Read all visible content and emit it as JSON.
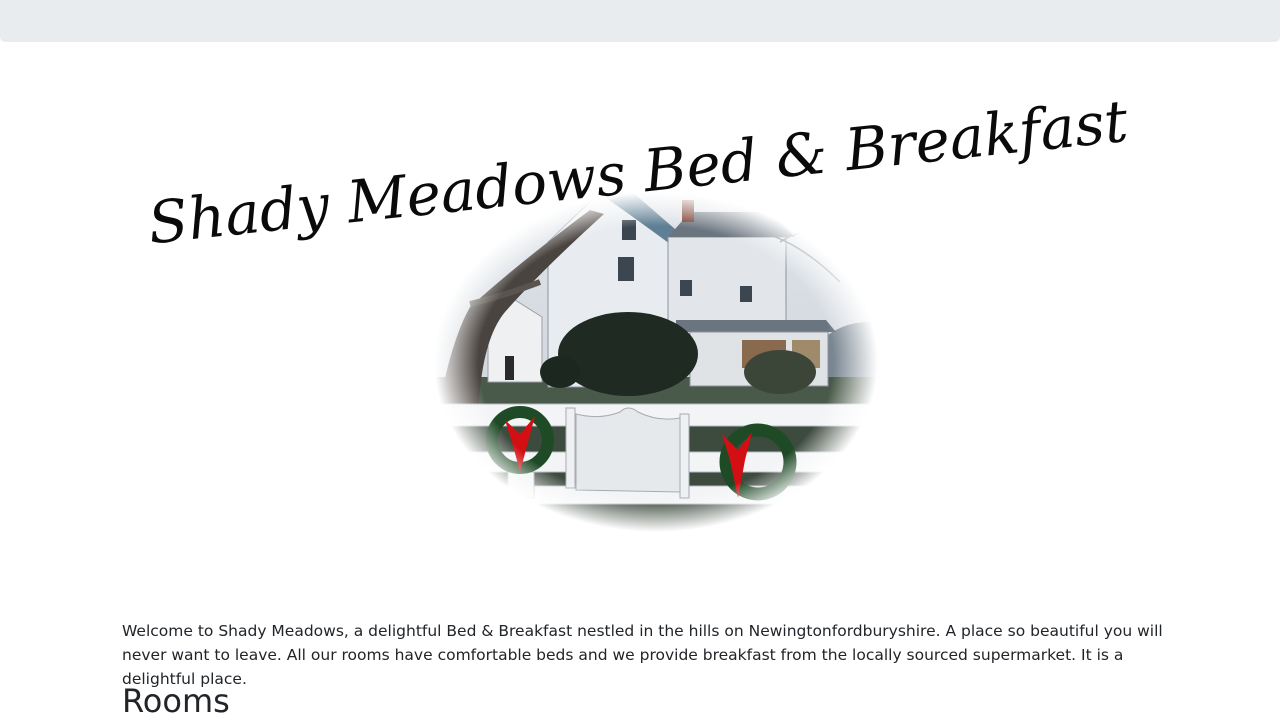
{
  "header": {
    "title": "Shady Meadows Bed & Breakfast"
  },
  "hero": {
    "image_icon": "bnb-house-photo-icon"
  },
  "main": {
    "welcome_text": "Welcome to Shady Meadows, a delightful Bed & Breakfast nestled in the hills on Newingtonfordburyshire. A place so beautiful you will never want to leave. All our rooms have comfortable beds and we provide breakfast from the locally sourced supermarket. It is a delightful place.",
    "rooms_heading": "Rooms"
  },
  "colors": {
    "topbar": "#e9ecef",
    "text": "#212529",
    "wreath_bow": "#d40f14",
    "wreath_green": "#1f4a26"
  }
}
